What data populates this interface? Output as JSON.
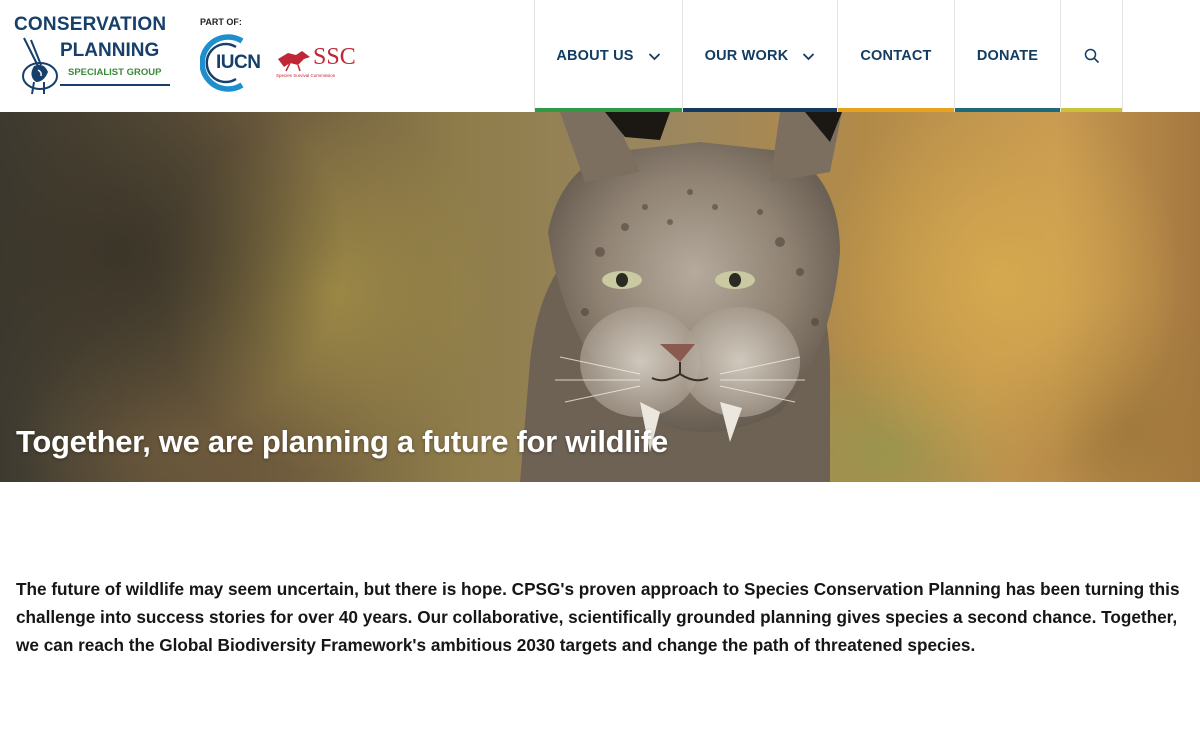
{
  "logo": {
    "line1": "CONSERVATION",
    "line2": "PLANNING",
    "line3": "SPECIALIST GROUP"
  },
  "partner": {
    "part_of_label": "PART OF:",
    "iucn_label": "IUCN",
    "ssc_label": "SSC",
    "ssc_subtitle": "Species Survival Commission"
  },
  "nav": {
    "items": [
      {
        "label": "ABOUT US",
        "has_dropdown": true,
        "accent": "#2e9a46"
      },
      {
        "label": "OUR WORK",
        "has_dropdown": true,
        "accent": "#143a5e"
      },
      {
        "label": "CONTACT",
        "has_dropdown": false,
        "accent": "#e8a21d"
      },
      {
        "label": "DONATE",
        "has_dropdown": false,
        "accent": "#1f6a7a"
      }
    ],
    "search_icon": "search-icon",
    "search_accent": "#c9c23a"
  },
  "hero": {
    "title": "Together, we are planning a future for wildlife"
  },
  "intro": {
    "text": "The future of wildlife may seem uncertain, but there is hope. CPSG's proven approach to Species Conservation Planning has been turning this challenge into success stories for over 40 years. Our collaborative, scientifically grounded planning gives species a second chance. Together, we can reach the Global Biodiversity Framework's ambitious 2030 targets and change the path of threatened species."
  },
  "colors": {
    "brand_navy": "#16406b",
    "brand_green": "#3a8a3a",
    "ssc_red": "#c02636"
  }
}
